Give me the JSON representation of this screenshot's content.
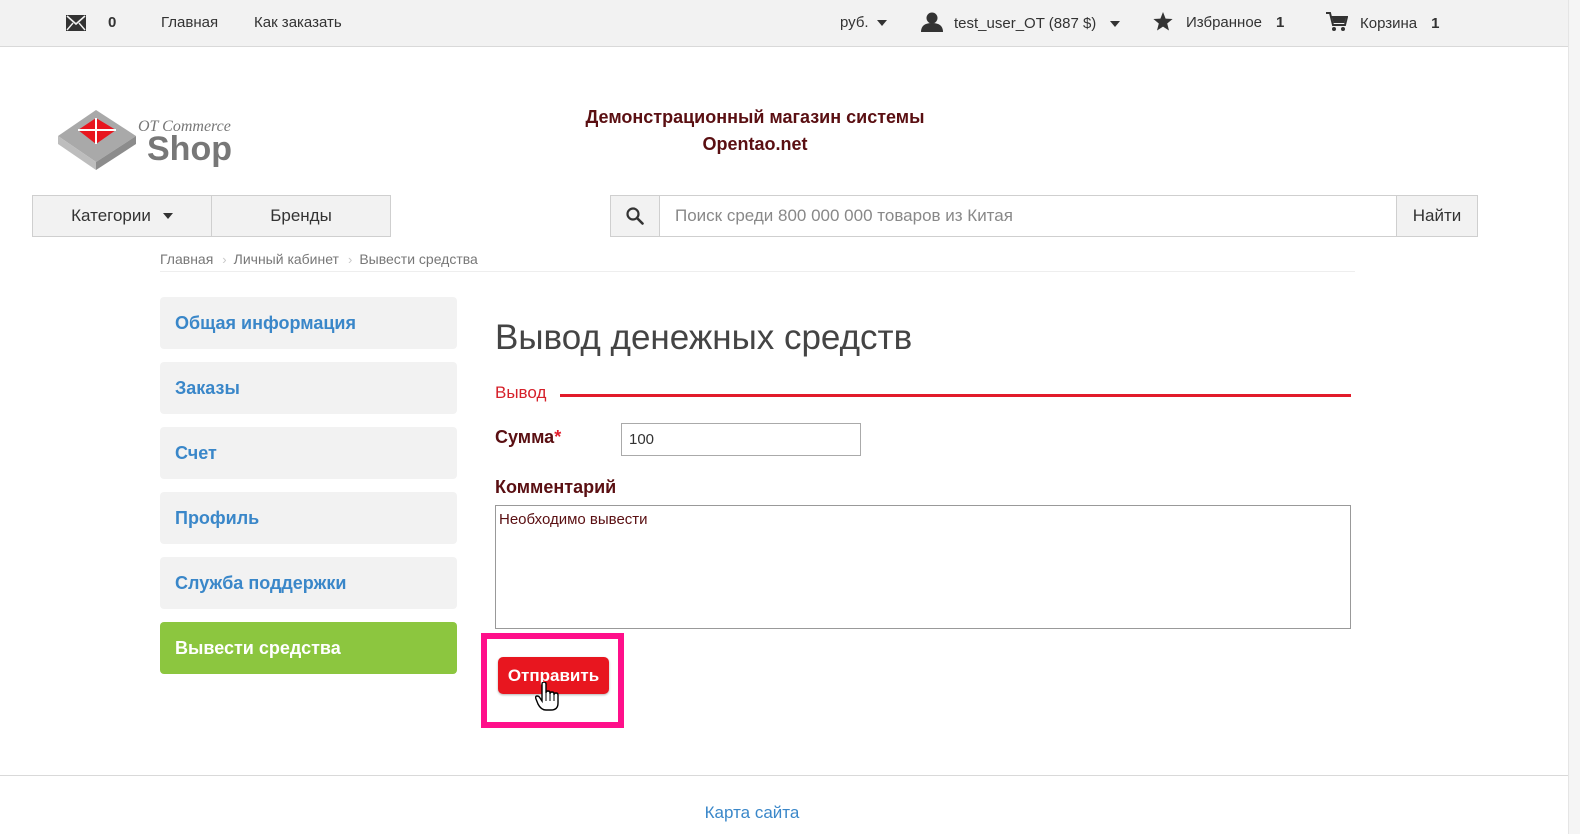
{
  "topbar": {
    "messages_count": "0",
    "home": "Главная",
    "how_to_order": "Как заказать",
    "currency": "руб.",
    "user": "test_user_OT (887 $)",
    "favorites_label": "Избранное",
    "favorites_count": "1",
    "cart_label": "Корзина",
    "cart_count": "1"
  },
  "header": {
    "logo_top": "OT Commerce",
    "logo_bottom": "Shop",
    "slogan_line1": "Демонстрационный магазин системы",
    "slogan_line2": "Opentao.net"
  },
  "nav": {
    "categories": "Категории",
    "brands": "Бренды",
    "search_placeholder": "Поиск среди 800 000 000 товаров из Китая",
    "search_button": "Найти"
  },
  "breadcrumb": [
    "Главная",
    "Личный кабинет",
    "Вывести средства"
  ],
  "sidebar": {
    "items": [
      {
        "label": "Общая информация"
      },
      {
        "label": "Заказы"
      },
      {
        "label": "Счет"
      },
      {
        "label": "Профиль"
      },
      {
        "label": "Служба поддержки"
      },
      {
        "label": "Вывести средства"
      }
    ],
    "active_index": 5
  },
  "form": {
    "title": "Вывод денежных средств",
    "legend": "Вывод",
    "sum_label": "Сумма",
    "sum_required_mark": "*",
    "sum_value": "100",
    "comment_label": "Комментарий",
    "comment_value": "Необходимо вывести",
    "submit": "Отправить"
  },
  "footer": {
    "sitemap": "Карта сайта"
  },
  "colors": {
    "accent_red": "#e21b2a",
    "active_green": "#8cc63f",
    "link_blue": "#3a87c9",
    "highlight_pink": "#ff0f8a",
    "dark_maroon": "#5a0f12"
  }
}
